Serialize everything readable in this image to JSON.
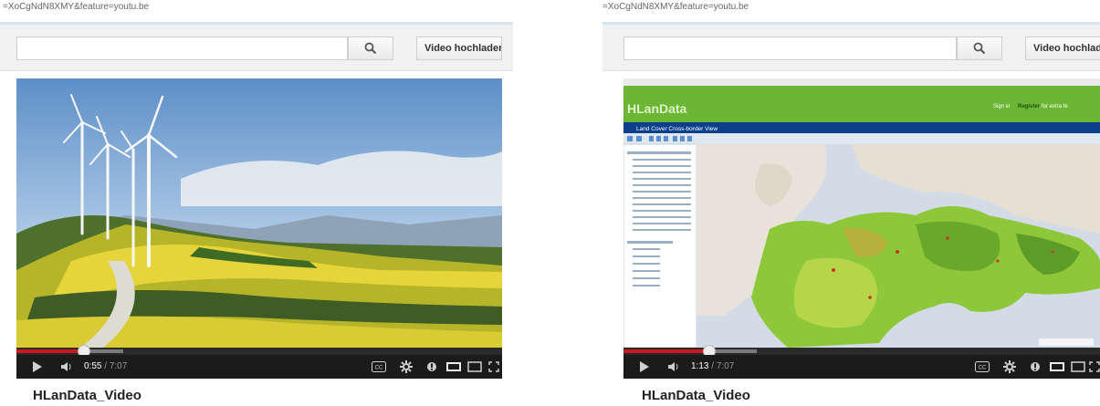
{
  "left": {
    "url_text": "=XoCgNdN8XMY&feature=youtu.be",
    "search": {
      "placeholder": "",
      "value": ""
    },
    "upload_label": "Video hochladen",
    "time_current": "0:55",
    "time_separator": " / ",
    "time_duration": "7:07",
    "progress_played": 0.14,
    "progress_buffered": 0.22,
    "video_title": "HLanData_Video",
    "icons": [
      "search-icon",
      "play-icon",
      "volume-icon",
      "captions-icon",
      "settings-gear-icon",
      "annotations-icon",
      "small-player-icon",
      "large-player-icon",
      "fullscreen-icon"
    ]
  },
  "right": {
    "url_text": "=XoCgNdN8XMY&feature=youtu.be",
    "search": {
      "placeholder": "",
      "value": ""
    },
    "upload_label": "Video hochladen",
    "time_current": "1:13",
    "time_separator": " / ",
    "time_duration": "7:07",
    "progress_played": 0.18,
    "progress_buffered": 0.28,
    "video_title": "HLanData_Video",
    "embedded_app": {
      "logo": "HLanData",
      "header_links": [
        "Sign in",
        "Register"
      ],
      "header_suffix": "for extra fe",
      "breadcrumb": "Land Cover Cross-border View"
    }
  },
  "colors": {
    "progress_played": "#cc181e",
    "controls_bg": "#1b1b1b",
    "hlandata_green": "#6bb634",
    "hlandata_blue": "#0b3f8a"
  }
}
